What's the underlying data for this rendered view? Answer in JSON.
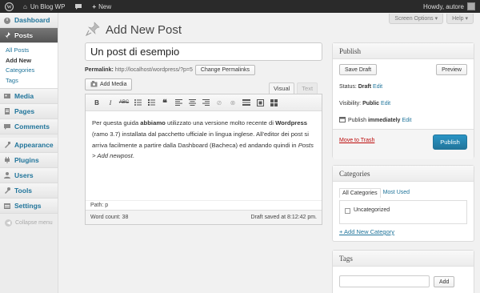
{
  "adminbar": {
    "site_name": "Un Blog WP",
    "new_label": "New",
    "howdy": "Howdy, autore"
  },
  "sidebar": {
    "items": [
      {
        "label": "Dashboard",
        "icon": "dashboard-icon"
      },
      {
        "label": "Posts",
        "icon": "pin-icon"
      },
      {
        "label": "Media",
        "icon": "media-icon"
      },
      {
        "label": "Pages",
        "icon": "pages-icon"
      },
      {
        "label": "Comments",
        "icon": "comments-icon"
      },
      {
        "label": "Appearance",
        "icon": "appearance-icon"
      },
      {
        "label": "Plugins",
        "icon": "plugins-icon"
      },
      {
        "label": "Users",
        "icon": "users-icon"
      },
      {
        "label": "Tools",
        "icon": "tools-icon"
      },
      {
        "label": "Settings",
        "icon": "settings-icon"
      }
    ],
    "submenu": [
      "All Posts",
      "Add New",
      "Categories",
      "Tags"
    ],
    "collapse_label": "Collapse menu"
  },
  "screen_options": "Screen Options",
  "help": "Help",
  "page_title": "Add New Post",
  "post": {
    "title": "Un post di esempio",
    "permalink_label": "Permalink:",
    "permalink_url": "http://localhost/wordpress/?p=5",
    "change_permalinks": "Change Permalinks",
    "add_media": "Add Media",
    "tab_visual": "Visual",
    "tab_text": "Text",
    "content": {
      "p1": "Per questa guida ",
      "b1": "abbiamo",
      "p2": " utilizzato una versione molto recente di ",
      "b2": "Wordpress",
      "p3": " (ramo 3.7) installata dal pacchetto ufficiale in lingua inglese. All'editor dei post si arriva facilmente a partire dalla Dashboard (Bacheca) ed andando quindi in ",
      "i1": "Posts > Add newpost",
      "p4": "."
    },
    "path": "Path: p",
    "word_count": "Word count: 38",
    "draft_saved": "Draft saved at 8:12:42 pm."
  },
  "publish": {
    "title": "Publish",
    "save_draft": "Save Draft",
    "preview": "Preview",
    "status_label": "Status:",
    "status_value": "Draft",
    "visibility_label": "Visibility:",
    "visibility_value": "Public",
    "publish_label": "Publish",
    "publish_value": "immediately",
    "edit": "Edit",
    "move_to_trash": "Move to Trash",
    "publish_button": "Publish"
  },
  "categories": {
    "title": "Categories",
    "tab_all": "All Categories",
    "tab_most": "Most Used",
    "items": [
      "Uncategorized"
    ],
    "add_new": "+ Add New Category"
  },
  "tags": {
    "title": "Tags",
    "add": "Add"
  },
  "colors": {
    "accent": "#21759b",
    "adminbar": "#2a2a2a",
    "trash": "#bc0b0b"
  }
}
